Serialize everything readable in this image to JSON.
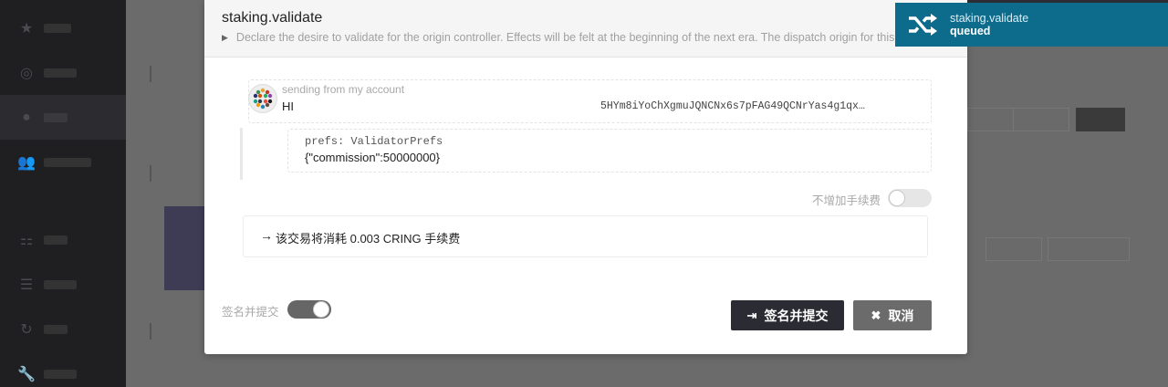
{
  "modal": {
    "title": "staking.validate",
    "description": "Declare the desire to validate for the origin controller. Effects will be felt at the beginning of the next era. The dispatch origin for this call must be _Signed_ by the controller, not the stash.",
    "account": {
      "label": "sending from my account",
      "name": "HI",
      "address": "5HYm8iYoChXgmuJQNCNx6s7pFAG49QCNrYas4g1qx…"
    },
    "param": {
      "label": "prefs: ValidatorPrefs",
      "value": "{\"commission\":50000000}"
    },
    "tip_toggle_label": "不增加手续费",
    "fee_text": "该交易将消耗 0.003 CRING 手续费",
    "sign_toggle_label": "签名并提交",
    "submit_label": "签名并提交",
    "cancel_label": "取消"
  },
  "toast": {
    "method": "staking.validate",
    "status": "queued"
  }
}
